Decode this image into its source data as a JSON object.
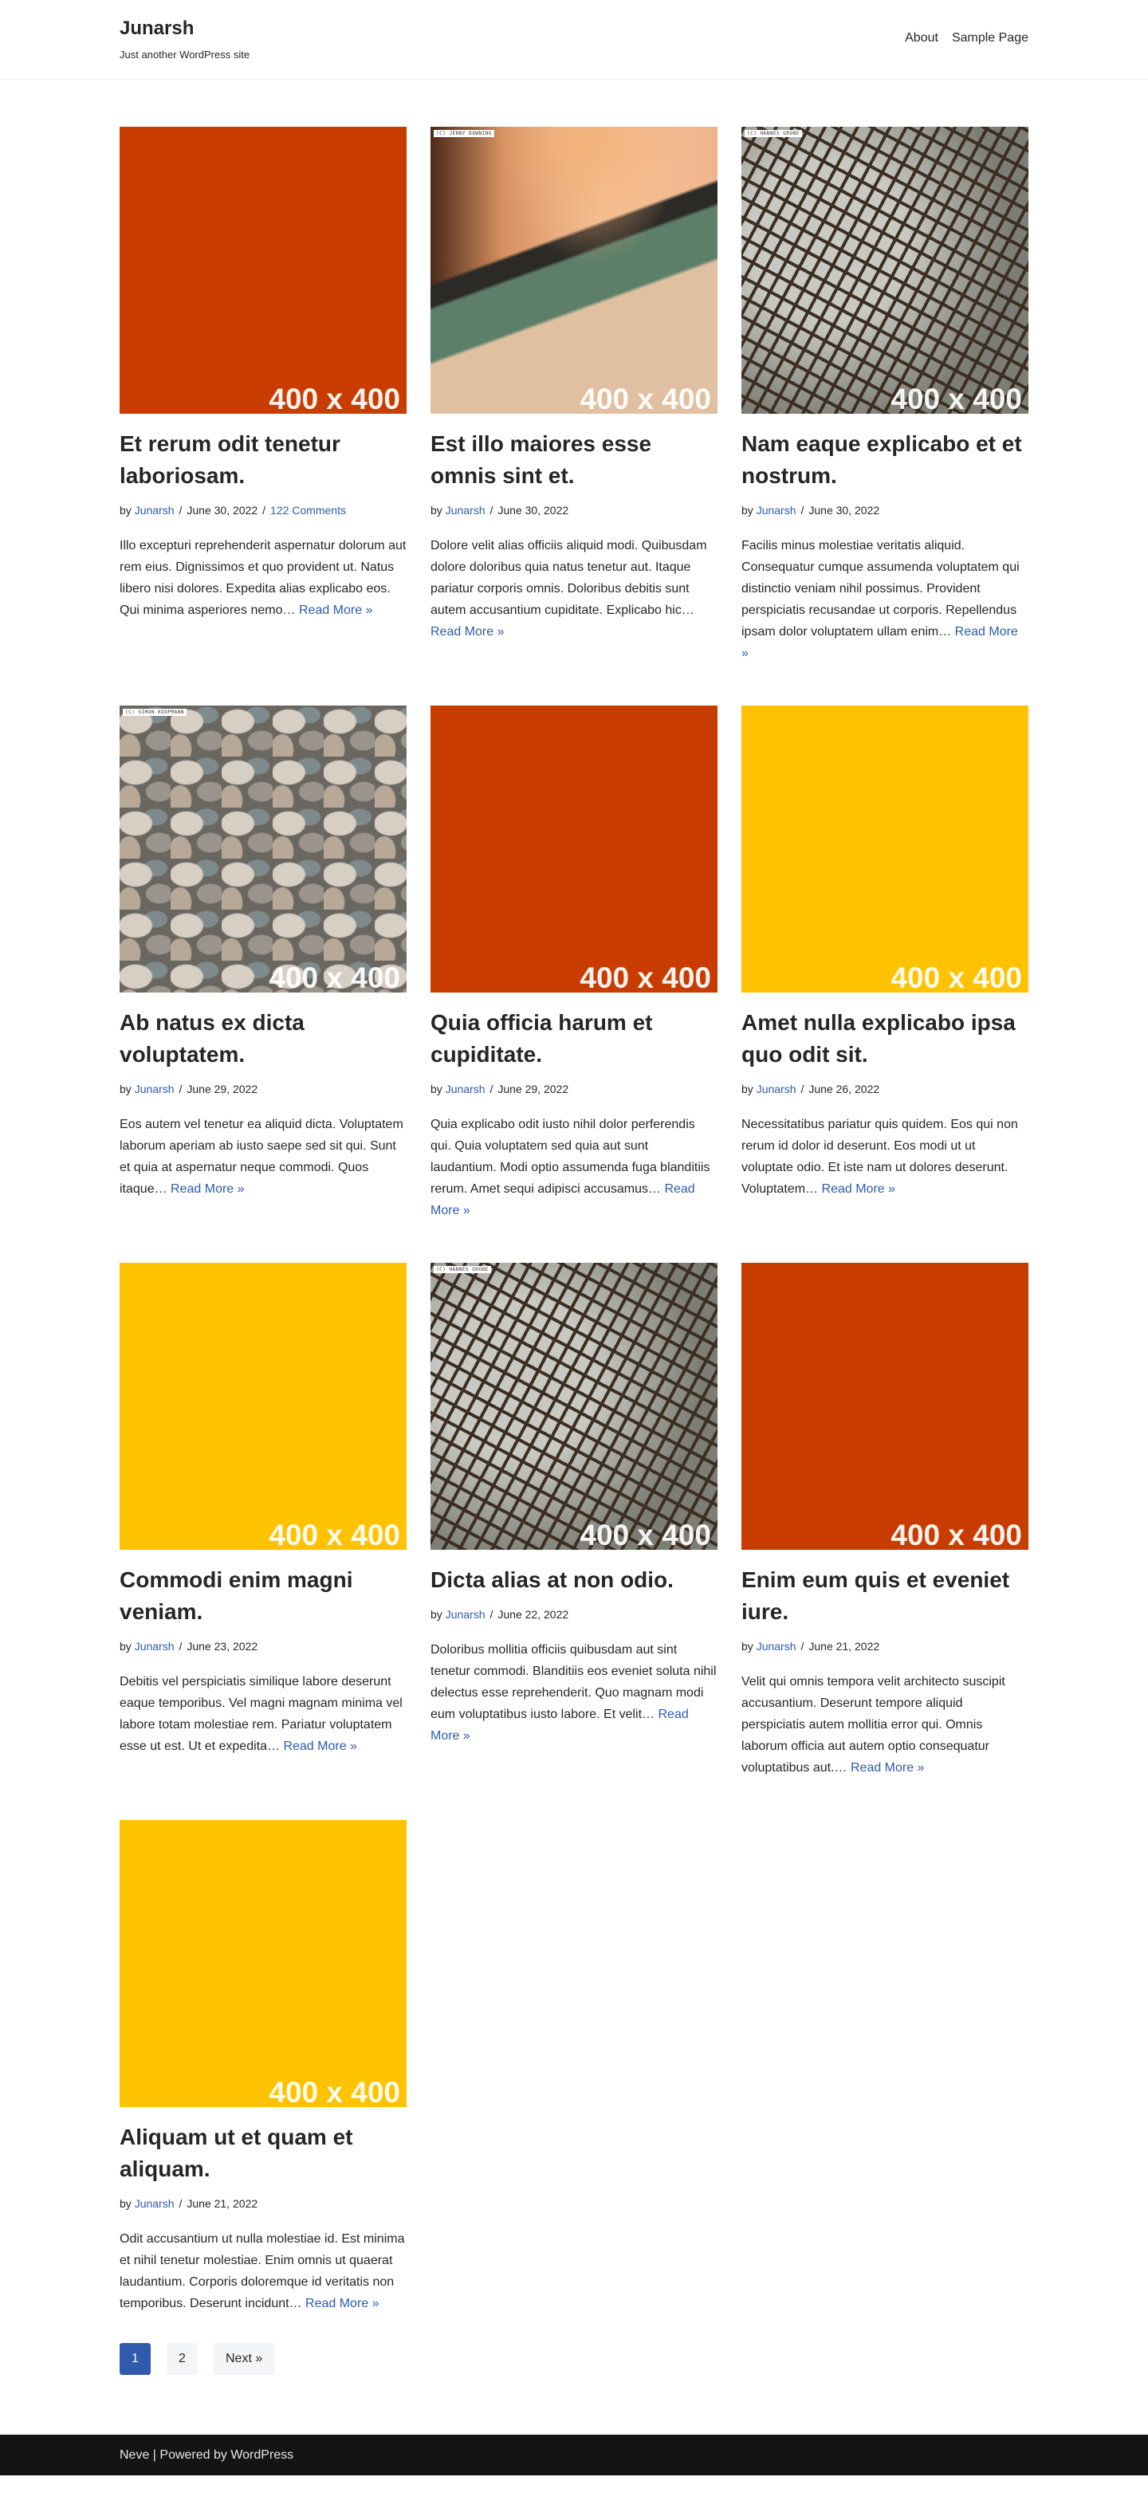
{
  "site": {
    "title": "Junarsh",
    "tagline": "Just another WordPress site"
  },
  "nav": [
    {
      "label": "About"
    },
    {
      "label": "Sample Page"
    }
  ],
  "meta": {
    "by": "by",
    "separator": "/"
  },
  "colors": {
    "accent": "#2f5aae",
    "orange": "#c83c00",
    "yellow": "#ffc200",
    "footer_bg": "#141414"
  },
  "posts": [
    {
      "title": "Et rerum odit tenetur laboriosam.",
      "author": "Junarsh",
      "date": "June 30, 2022",
      "comments": "122 Comments",
      "excerpt": "Illo excepturi reprehenderit aspernatur dolorum aut rem eius. Dignissimos et quo provident ut. Natus libero nisi dolores. Expedita alias explicabo eos. Qui minima asperiores nemo…",
      "read_more": "Read More »",
      "image": {
        "label": "400 x 400",
        "color": "#c83c00"
      }
    },
    {
      "title": "Est illo maiores esse omnis sint et.",
      "author": "Junarsh",
      "date": "June 30, 2022",
      "excerpt": "Dolore velit alias officiis aliquid modi. Quibusdam dolore doloribus quia natus tenetur aut. Itaque pariatur corporis omnis. Doloribus debitis sunt autem accusantium cupiditate. Explicabo hic…",
      "read_more": "Read More »",
      "image": {
        "label": "400 x 400",
        "pattern": "paper",
        "credit": "(C) JENNY DOWNING"
      }
    },
    {
      "title": "Nam eaque explicabo et et nostrum.",
      "author": "Junarsh",
      "date": "June 30, 2022",
      "excerpt": "Facilis minus molestiae veritatis aliquid. Consequatur cumque assumenda voluptatem qui distinctio veniam nihil possimus. Provident perspiciatis recusandae ut corporis. Repellendus ipsam dolor voluptatem ullam enim…",
      "read_more": "Read More »",
      "image": {
        "label": "400 x 400",
        "pattern": "crack",
        "credit": "(C) HANNES GROBE"
      }
    },
    {
      "title": "Ab natus ex dicta voluptatem.",
      "author": "Junarsh",
      "date": "June 29, 2022",
      "excerpt": "Eos autem vel tenetur ea aliquid dicta. Voluptatem laborum aperiam ab iusto saepe sed sit qui. Sunt et quia at aspernatur neque commodi. Quos itaque…",
      "read_more": "Read More »",
      "image": {
        "label": "400 x 400",
        "pattern": "stones",
        "credit": "(C) SIMON KOOPMANN"
      }
    },
    {
      "title": "Quia officia harum et cupiditate.",
      "author": "Junarsh",
      "date": "June 29, 2022",
      "excerpt": "Quia explicabo odit iusto nihil dolor perferendis qui. Quia voluptatem sed quia aut sunt laudantium. Modi optio assumenda fuga blanditiis rerum. Amet sequi adipisci accusamus…",
      "read_more": "Read More »",
      "image": {
        "label": "400 x 400",
        "color": "#c83c00"
      }
    },
    {
      "title": "Amet nulla explicabo ipsa quo odit sit.",
      "author": "Junarsh",
      "date": "June 26, 2022",
      "excerpt": "Necessitatibus pariatur quis quidem. Eos qui non rerum id dolor id deserunt. Eos modi ut ut voluptate odio. Et iste nam ut dolores deserunt. Voluptatem…",
      "read_more": "Read More »",
      "image": {
        "label": "400 x 400",
        "color": "#ffc200"
      }
    },
    {
      "title": "Commodi enim magni veniam.",
      "author": "Junarsh",
      "date": "June 23, 2022",
      "excerpt": "Debitis vel perspiciatis similique labore deserunt eaque temporibus. Vel magni magnam minima vel labore totam molestiae rem. Pariatur voluptatem esse ut est. Ut et expedita…",
      "read_more": "Read More »",
      "image": {
        "label": "400 x 400",
        "color": "#ffc200"
      }
    },
    {
      "title": "Dicta alias at non odio.",
      "author": "Junarsh",
      "date": "June 22, 2022",
      "excerpt": "Doloribus mollitia officiis quibusdam aut sint tenetur commodi. Blanditiis eos eveniet soluta nihil delectus esse reprehenderit. Quo magnam modi eum voluptatibus iusto labore. Et velit…",
      "read_more": "Read More »",
      "image": {
        "label": "400 x 400",
        "pattern": "crack",
        "credit": "(C) HANNES GROBE"
      }
    },
    {
      "title": "Enim eum quis et eveniet iure.",
      "author": "Junarsh",
      "date": "June 21, 2022",
      "excerpt": "Velit qui omnis tempora velit architecto suscipit accusantium. Deserunt tempore aliquid perspiciatis autem mollitia error qui. Omnis laborum officia aut autem optio consequatur voluptatibus aut.…",
      "read_more": "Read More »",
      "image": {
        "label": "400 x 400",
        "color": "#c83c00"
      }
    },
    {
      "title": "Aliquam ut et quam et aliquam.",
      "author": "Junarsh",
      "date": "June 21, 2022",
      "excerpt": "Odit accusantium ut nulla molestiae id. Est minima et nihil tenetur molestiae. Enim omnis ut quaerat laudantium. Corporis doloremque id veritatis non temporibus. Deserunt incidunt…",
      "read_more": "Read More »",
      "image": {
        "label": "400 x 400",
        "color": "#ffc200"
      }
    }
  ],
  "pagination": {
    "pages": [
      "1",
      "2"
    ],
    "current": "1",
    "next": "Next »"
  },
  "footer": {
    "text": "Neve | Powered by WordPress"
  }
}
